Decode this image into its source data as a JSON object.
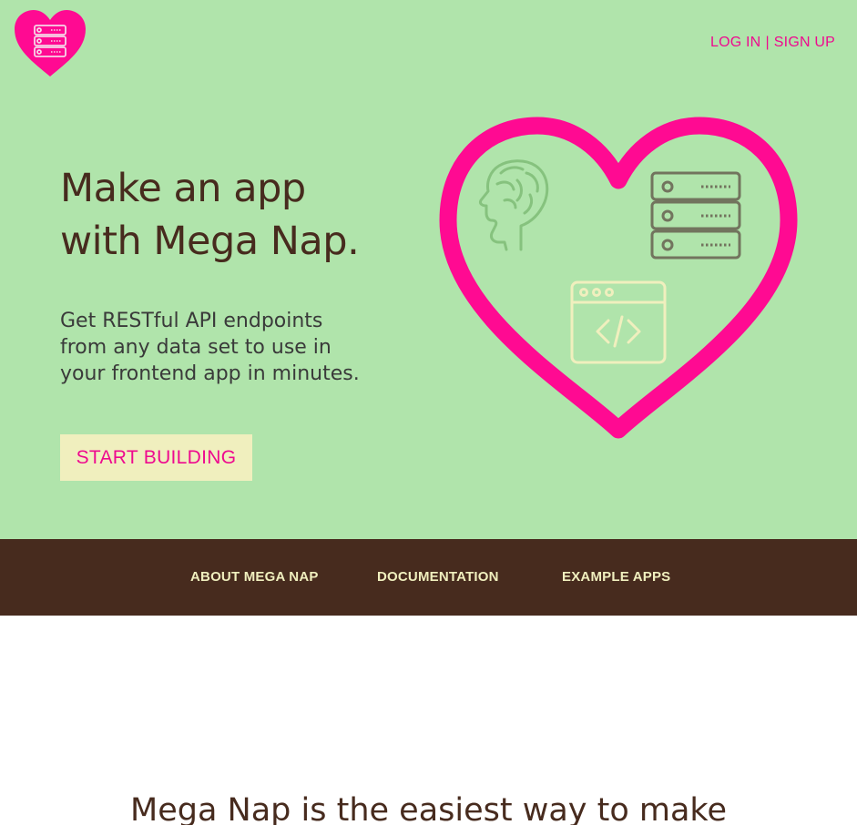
{
  "header": {
    "login_label": "LOG IN",
    "separator": "|",
    "signup_label": "SIGN UP"
  },
  "hero": {
    "headline_line1": "Make an app",
    "headline_line2": "with Mega Nap.",
    "subtitle": "Get RESTful API endpoints from any data set to use in your frontend app in minutes.",
    "cta_label": "START BUILDING"
  },
  "nav": {
    "items": [
      {
        "label": "ABOUT MEGA NAP"
      },
      {
        "label": "DOCUMENTATION"
      },
      {
        "label": "EXAMPLE APPS"
      }
    ]
  },
  "section": {
    "title": "Mega Nap is the easiest way to make"
  },
  "icons": {
    "logo": "heart-server-logo-icon",
    "brain": "brain-head-icon",
    "server": "server-stack-icon",
    "code": "code-window-icon",
    "heart": "heart-outline-icon"
  },
  "colors": {
    "hero_bg": "#b0e4ab",
    "accent_pink": "#ee0a8f",
    "brown": "#472b1e",
    "cream": "#f0efbe"
  }
}
